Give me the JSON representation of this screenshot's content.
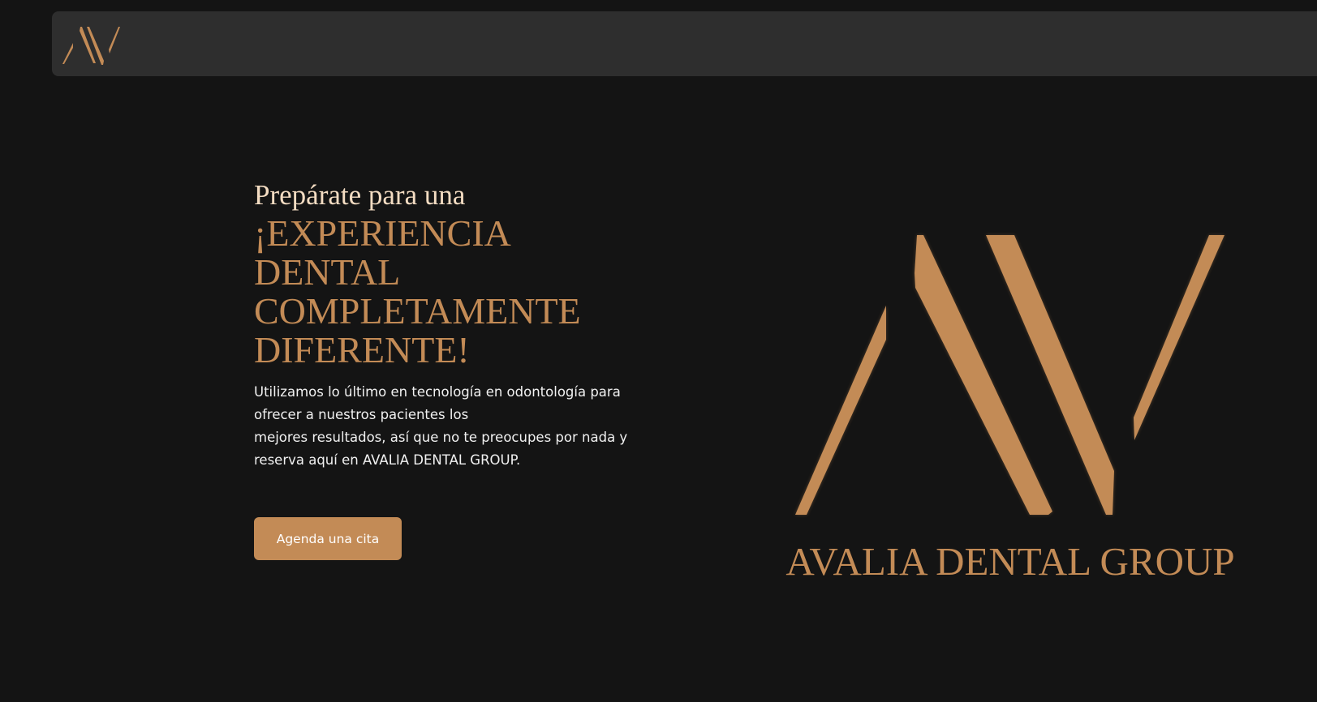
{
  "colors": {
    "background": "#141414",
    "navbar": "#2e2e2e",
    "accent": "#c38b56",
    "pretitle": "#f3dcc2",
    "body_text": "#f1f1f1"
  },
  "header": {
    "logo_icon": "avalia-monogram-icon"
  },
  "hero": {
    "pretitle": "Prepárate para una",
    "headline_lines": [
      "¡EXPERIENCIA",
      "DENTAL",
      "COMPLETAMENTE",
      "DIFERENTE!"
    ],
    "description_lines": [
      "Utilizamos lo último en tecnología en odontología para",
      "ofrecer a nuestros pacientes los",
      "mejores resultados, así que no te preocupes por nada y",
      "reserva aquí en AVALIA DENTAL GROUP."
    ],
    "cta_label": "Agenda una cita"
  },
  "brand": {
    "logo_icon": "avalia-monogram-icon",
    "name": "AVALIA DENTAL GROUP"
  }
}
